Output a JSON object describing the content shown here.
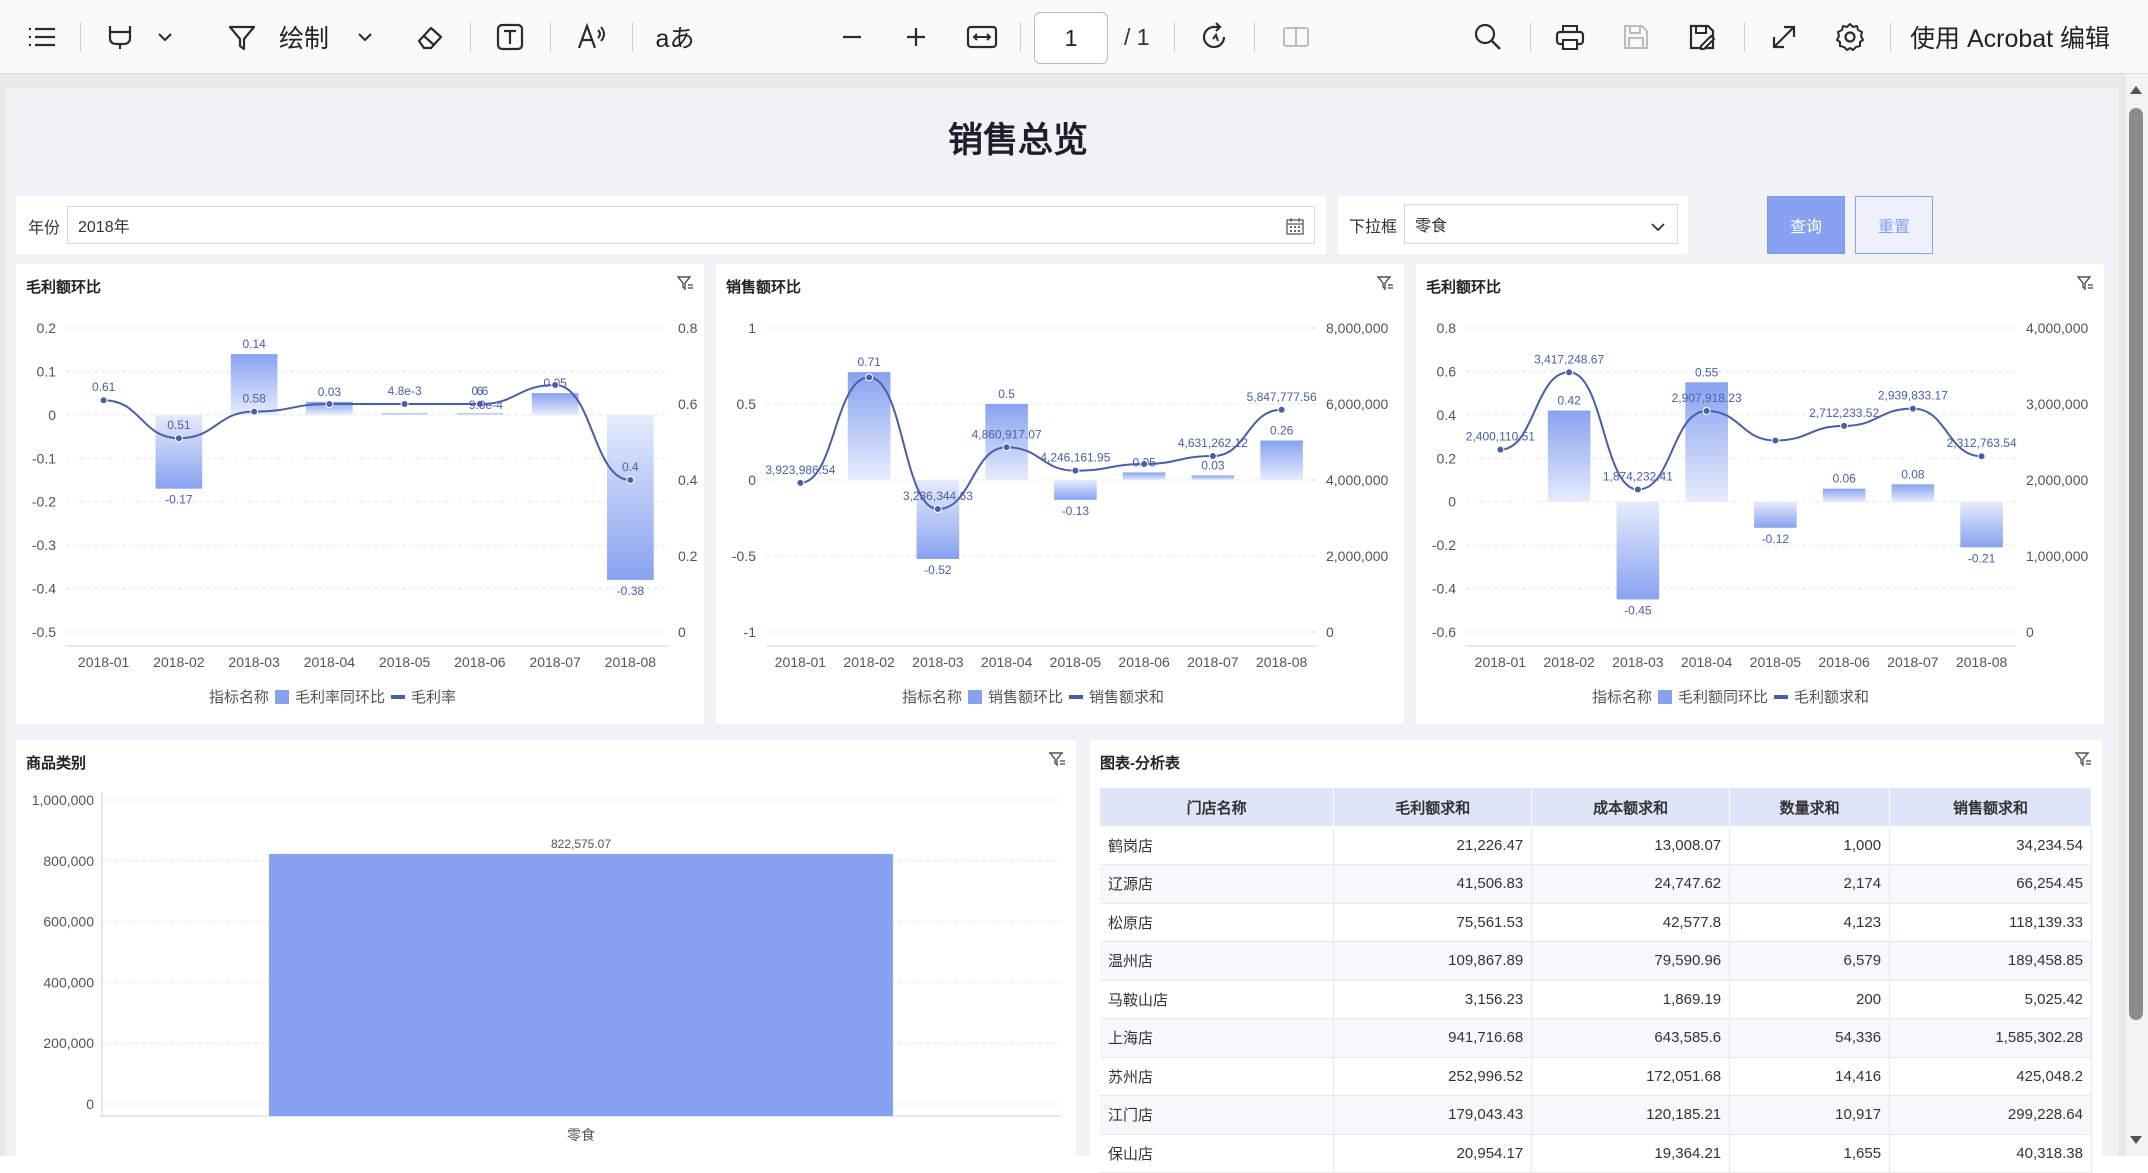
{
  "toolbar": {
    "draw_label": "绘制",
    "text_ab_label": "aあ",
    "page_current": "1",
    "page_total": "/ 1",
    "edit_label": "使用 Acrobat 编辑",
    "icons": [
      "menu-icon",
      "highlight-pen-icon",
      "chevron-down-icon",
      "draw-icon",
      "eraser-icon",
      "text-box-icon",
      "read-aloud-icon",
      "translate-icon",
      "zoom-out-icon",
      "zoom-in-icon",
      "fit-width-icon",
      "rotate-icon",
      "page-split-icon",
      "search-icon",
      "print-icon",
      "save-icon",
      "save-as-icon",
      "fullscreen-icon",
      "settings-icon"
    ]
  },
  "dashboard": {
    "title": "销售总览",
    "filters": {
      "year_label": "年份",
      "year_value": "2018年",
      "dropdown_label": "下拉框",
      "dropdown_value": "零食",
      "query_button": "查询",
      "reset_button": "重置"
    }
  },
  "colors": {
    "bar": "#87a2f0",
    "line": "#4a5ea8",
    "accent": "#87a2f0"
  },
  "chart_data": [
    {
      "type": "bar+line",
      "title": "毛利额环比",
      "categories": [
        "2018-01",
        "2018-02",
        "2018-03",
        "2018-04",
        "2018-05",
        "2018-06",
        "2018-07",
        "2018-08"
      ],
      "legend_title": "指标名称",
      "series": [
        {
          "name": "毛利率同环比",
          "type": "bar",
          "axis": "left",
          "values": [
            null,
            -0.17,
            0.14,
            0.03,
            0.0,
            0.0,
            0.05,
            -0.38
          ],
          "labels": [
            "",
            "-0.17",
            "0.14",
            "0.03",
            "",
            "",
            "0.05",
            "-0.38"
          ]
        },
        {
          "name": "毛利率",
          "type": "line",
          "axis": "right",
          "values": [
            0.61,
            0.51,
            0.58,
            0.6,
            0.6,
            0.6,
            0.65,
            0.4
          ],
          "labels": [
            "0.61",
            "0.51",
            "0.58",
            "",
            "4.8e-3",
            "6",
            "",
            "0.4"
          ]
        }
      ],
      "extra_labels": [
        "0.6",
        "9.9e-4"
      ],
      "ylim_left": [
        -0.5,
        0.2
      ],
      "yticks_left": [
        "0.2",
        "0.1",
        "0",
        "-0.1",
        "-0.2",
        "-0.3",
        "-0.4",
        "-0.5"
      ],
      "ylim_right": [
        0,
        0.8
      ],
      "yticks_right": [
        "0.8",
        "0.6",
        "0.4",
        "0.2",
        "0"
      ],
      "grid": true,
      "legend": "bottom"
    },
    {
      "type": "bar+line",
      "title": "销售额环比",
      "categories": [
        "2018-01",
        "2018-02",
        "2018-03",
        "2018-04",
        "2018-05",
        "2018-06",
        "2018-07",
        "2018-08"
      ],
      "legend_title": "指标名称",
      "series": [
        {
          "name": "销售额环比",
          "type": "bar",
          "axis": "left",
          "values": [
            null,
            0.71,
            -0.52,
            0.5,
            -0.13,
            0.05,
            0.03,
            0.26
          ],
          "labels": [
            "",
            "0.71",
            "-0.52",
            "0.5",
            "-0.13",
            "0.05",
            "0.03",
            "0.26"
          ]
        },
        {
          "name": "销售额求和",
          "type": "line",
          "axis": "right",
          "values": [
            3923986.54,
            6700000,
            3236344.63,
            4860917.07,
            4246161.95,
            4420000,
            4631262.12,
            5847777.56
          ],
          "labels": [
            "3,923,986.54",
            "",
            "3,236,344.63",
            "4,860,917.07",
            "4,246,161.95",
            "",
            "4,631,262.12",
            "5,847,777.56"
          ]
        }
      ],
      "ylim_left": [
        -1,
        1
      ],
      "yticks_left": [
        "1",
        "0.5",
        "0",
        "-0.5",
        "-1"
      ],
      "ylim_right": [
        0,
        8000000
      ],
      "yticks_right": [
        "8,000,000",
        "6,000,000",
        "4,000,000",
        "2,000,000",
        "0"
      ],
      "grid": true,
      "legend": "bottom"
    },
    {
      "type": "bar+line",
      "title": "毛利额环比",
      "categories": [
        "2018-01",
        "2018-02",
        "2018-03",
        "2018-04",
        "2018-05",
        "2018-06",
        "2018-07",
        "2018-08"
      ],
      "legend_title": "指标名称",
      "series": [
        {
          "name": "毛利额同环比",
          "type": "bar",
          "axis": "left",
          "values": [
            null,
            0.42,
            -0.45,
            0.55,
            -0.12,
            0.06,
            0.08,
            -0.21
          ],
          "labels": [
            "",
            "0.42",
            "-0.45",
            "0.55",
            "-0.12",
            "0.06",
            "0.08",
            "-0.21"
          ]
        },
        {
          "name": "毛利额求和",
          "type": "line",
          "axis": "right",
          "values": [
            2400110.51,
            3417248.67,
            1874232.41,
            2907918.23,
            2520000,
            2712233.52,
            2939833.17,
            2312763.54
          ],
          "labels": [
            "2,400,110.51",
            "3,417,248.67",
            "1,874,232.41",
            "2,907,918.23",
            "",
            "2,712,233.52",
            "2,939,833.17",
            "2,312,763.54"
          ]
        }
      ],
      "ylim_left": [
        -0.6,
        0.8
      ],
      "yticks_left": [
        "0.8",
        "0.6",
        "0.4",
        "0.2",
        "0",
        "-0.2",
        "-0.4",
        "-0.6"
      ],
      "ylim_right": [
        0,
        4000000
      ],
      "yticks_right": [
        "4,000,000",
        "3,000,000",
        "2,000,000",
        "1,000,000",
        "0"
      ],
      "grid": true,
      "legend": "bottom"
    },
    {
      "type": "bar",
      "title": "商品类别",
      "categories": [
        "零食"
      ],
      "values": [
        822575.07
      ],
      "labels": [
        "822,575.07"
      ],
      "ylim": [
        0,
        1000000
      ],
      "yticks": [
        "1,000,000",
        "800,000",
        "600,000",
        "400,000",
        "200,000",
        "0"
      ],
      "grid": true
    },
    {
      "type": "table",
      "title": "图表-分析表",
      "columns": [
        "门店名称",
        "毛利额求和",
        "成本额求和",
        "数量求和",
        "销售额求和"
      ],
      "rows": [
        [
          "鹤岗店",
          "21,226.47",
          "13,008.07",
          "1,000",
          "34,234.54"
        ],
        [
          "辽源店",
          "41,506.83",
          "24,747.62",
          "2,174",
          "66,254.45"
        ],
        [
          "松原店",
          "75,561.53",
          "42,577.8",
          "4,123",
          "118,139.33"
        ],
        [
          "温州店",
          "109,867.89",
          "79,590.96",
          "6,579",
          "189,458.85"
        ],
        [
          "马鞍山店",
          "3,156.23",
          "1,869.19",
          "200",
          "5,025.42"
        ],
        [
          "上海店",
          "941,716.68",
          "643,585.6",
          "54,336",
          "1,585,302.28"
        ],
        [
          "苏州店",
          "252,996.52",
          "172,051.68",
          "14,416",
          "425,048.2"
        ],
        [
          "江门店",
          "179,043.43",
          "120,185.21",
          "10,917",
          "299,228.64"
        ],
        [
          "保山店",
          "20,954.17",
          "19,364.21",
          "1,655",
          "40,318.38"
        ]
      ]
    }
  ]
}
